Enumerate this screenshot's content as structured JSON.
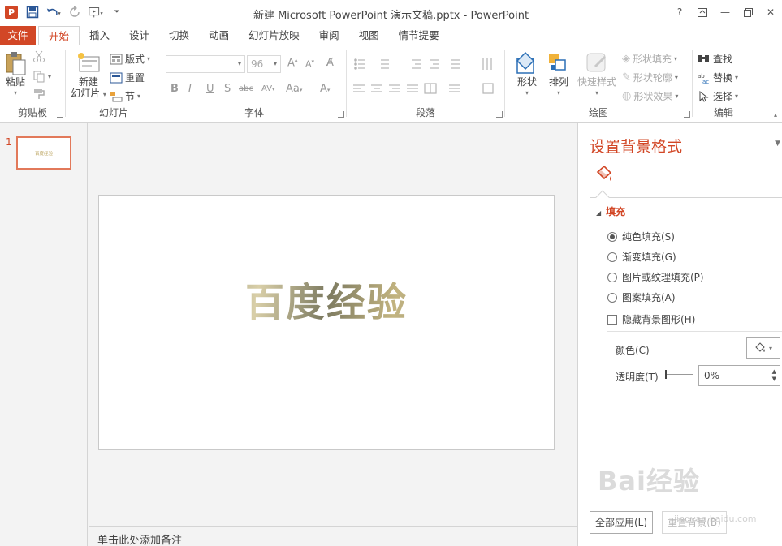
{
  "titlebar": {
    "title": "新建 Microsoft PowerPoint 演示文稿.pptx - PowerPoint",
    "help": "?",
    "minimize": "—",
    "close": "✕"
  },
  "tabs": [
    "文件",
    "开始",
    "插入",
    "设计",
    "切换",
    "动画",
    "幻灯片放映",
    "审阅",
    "视图",
    "情节提要"
  ],
  "ribbon": {
    "clipboard": {
      "paste": "粘贴",
      "group": "剪贴板"
    },
    "slides": {
      "new_slide_1": "新建",
      "new_slide_2": "幻灯片",
      "layout": "版式",
      "reset": "重置",
      "section": "节",
      "group": "幻灯片"
    },
    "font": {
      "size": "96",
      "group": "字体"
    },
    "paragraph": {
      "group": "段落"
    },
    "drawing": {
      "shapes": "形状",
      "arrange": "排列",
      "quick_styles": "快速样式",
      "shape_fill": "形状填充",
      "shape_outline": "形状轮廓",
      "shape_effects": "形状效果",
      "group": "绘图"
    },
    "editing": {
      "find": "查找",
      "replace": "替换",
      "select": "选择",
      "group": "编辑"
    }
  },
  "thumbnails": {
    "number": "1",
    "text": "百度经验"
  },
  "slide": {
    "text": "百度经验"
  },
  "notes": {
    "placeholder": "单击此处添加备注"
  },
  "format_pane": {
    "title": "设置背景格式",
    "section": "填充",
    "options": [
      {
        "label": "纯色填充(S)",
        "checked": true
      },
      {
        "label": "渐变填充(G)",
        "checked": false
      },
      {
        "label": "图片或纹理填充(P)",
        "checked": false
      },
      {
        "label": "图案填充(A)",
        "checked": false
      }
    ],
    "hide_graphics": "隐藏背景图形(H)",
    "color_label": "颜色(C)",
    "transparency_label": "透明度(T)",
    "transparency_value": "0%",
    "apply_all": "全部应用(L)",
    "reset_bg": "重置背景(B)"
  },
  "colors": {
    "accent": "#d24726"
  },
  "watermark": {
    "text": "Bai经验",
    "sub": "jingyan.baidu.com"
  }
}
